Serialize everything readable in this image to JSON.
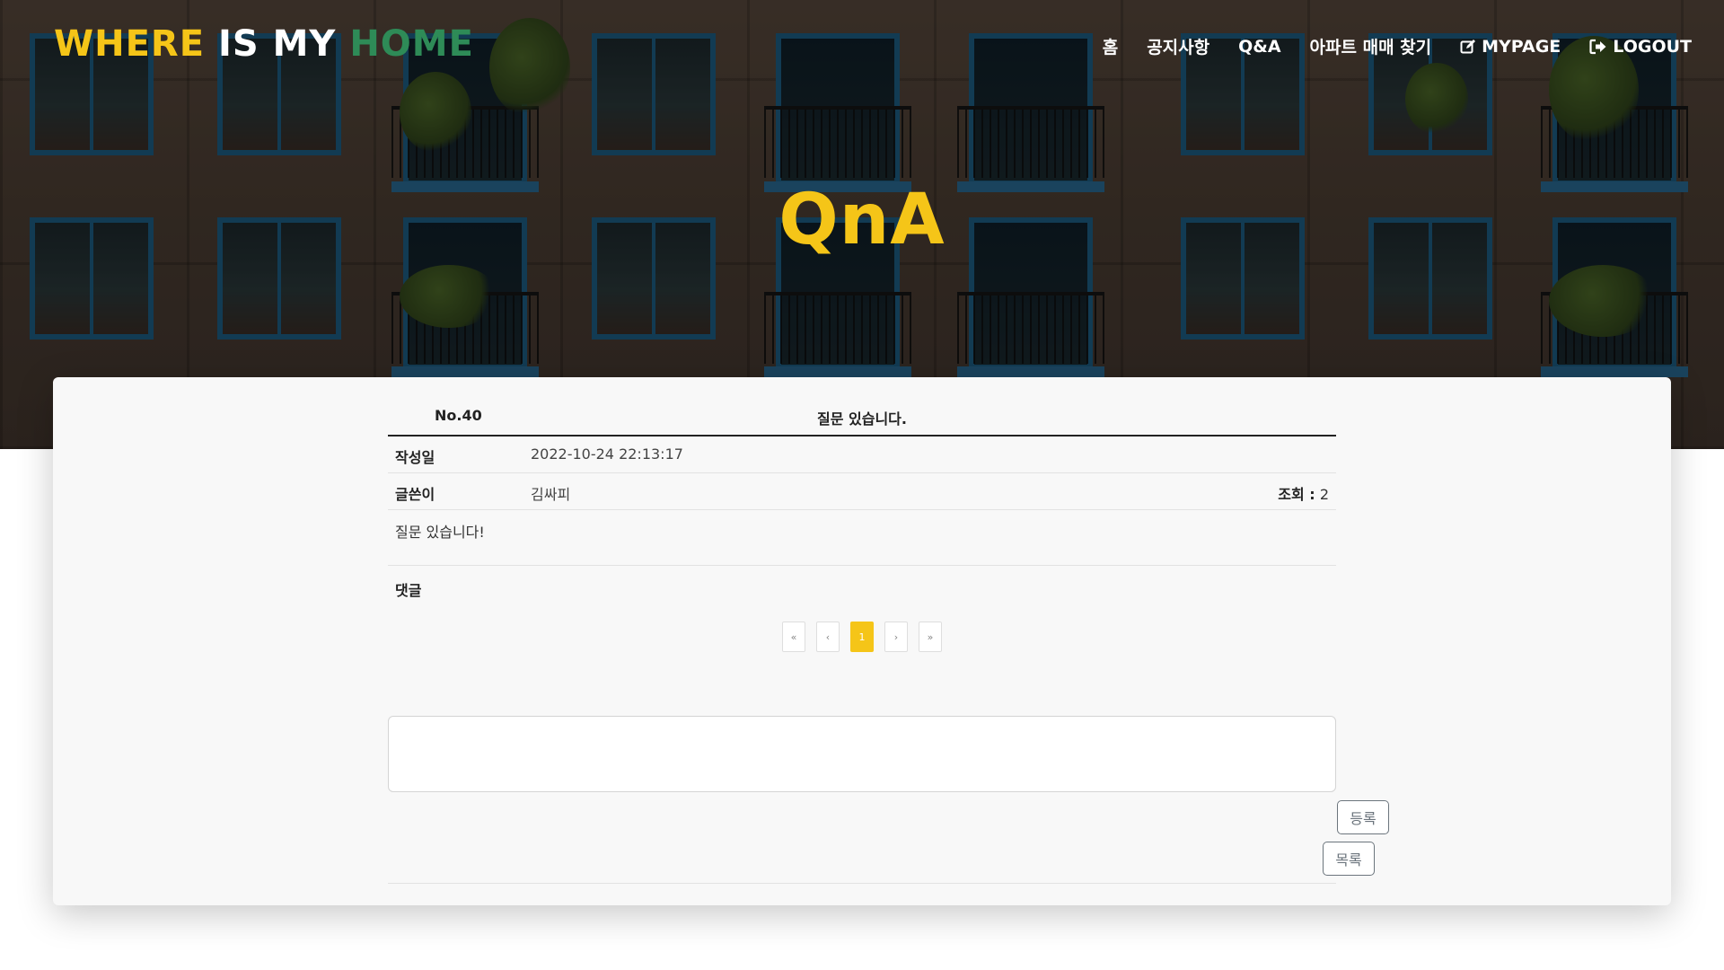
{
  "brand": {
    "word1": "WHERE",
    "word2": "IS MY",
    "word3": "HOME"
  },
  "nav": {
    "items": [
      {
        "label": "홈"
      },
      {
        "label": "공지사항"
      },
      {
        "label": "Q&A"
      },
      {
        "label": "아파트 매매 찾기"
      },
      {
        "label": "MYPAGE",
        "icon": "edit-icon"
      },
      {
        "label": "LOGOUT",
        "icon": "logout-icon"
      }
    ]
  },
  "hero": {
    "title": "QnA"
  },
  "post": {
    "number": "No.40",
    "title": "질문 있습니다.",
    "date_label": "작성일",
    "date_value": "2022-10-24 22:13:17",
    "author_label": "글쓴이",
    "author_value": "김싸피",
    "views_label": "조회 :",
    "views_value": "2",
    "body": "질문 있습니다!"
  },
  "comments": {
    "header": "댓글",
    "pagination": {
      "first": "«",
      "prev": "‹",
      "current": "1",
      "next": "›",
      "last": "»"
    },
    "input_placeholder": "",
    "submit_label": "등록"
  },
  "actions": {
    "list_label": "목록"
  },
  "colors": {
    "accent": "#f5c518",
    "brand_green": "#2e8b57",
    "window_frame": "#1d5f86"
  }
}
